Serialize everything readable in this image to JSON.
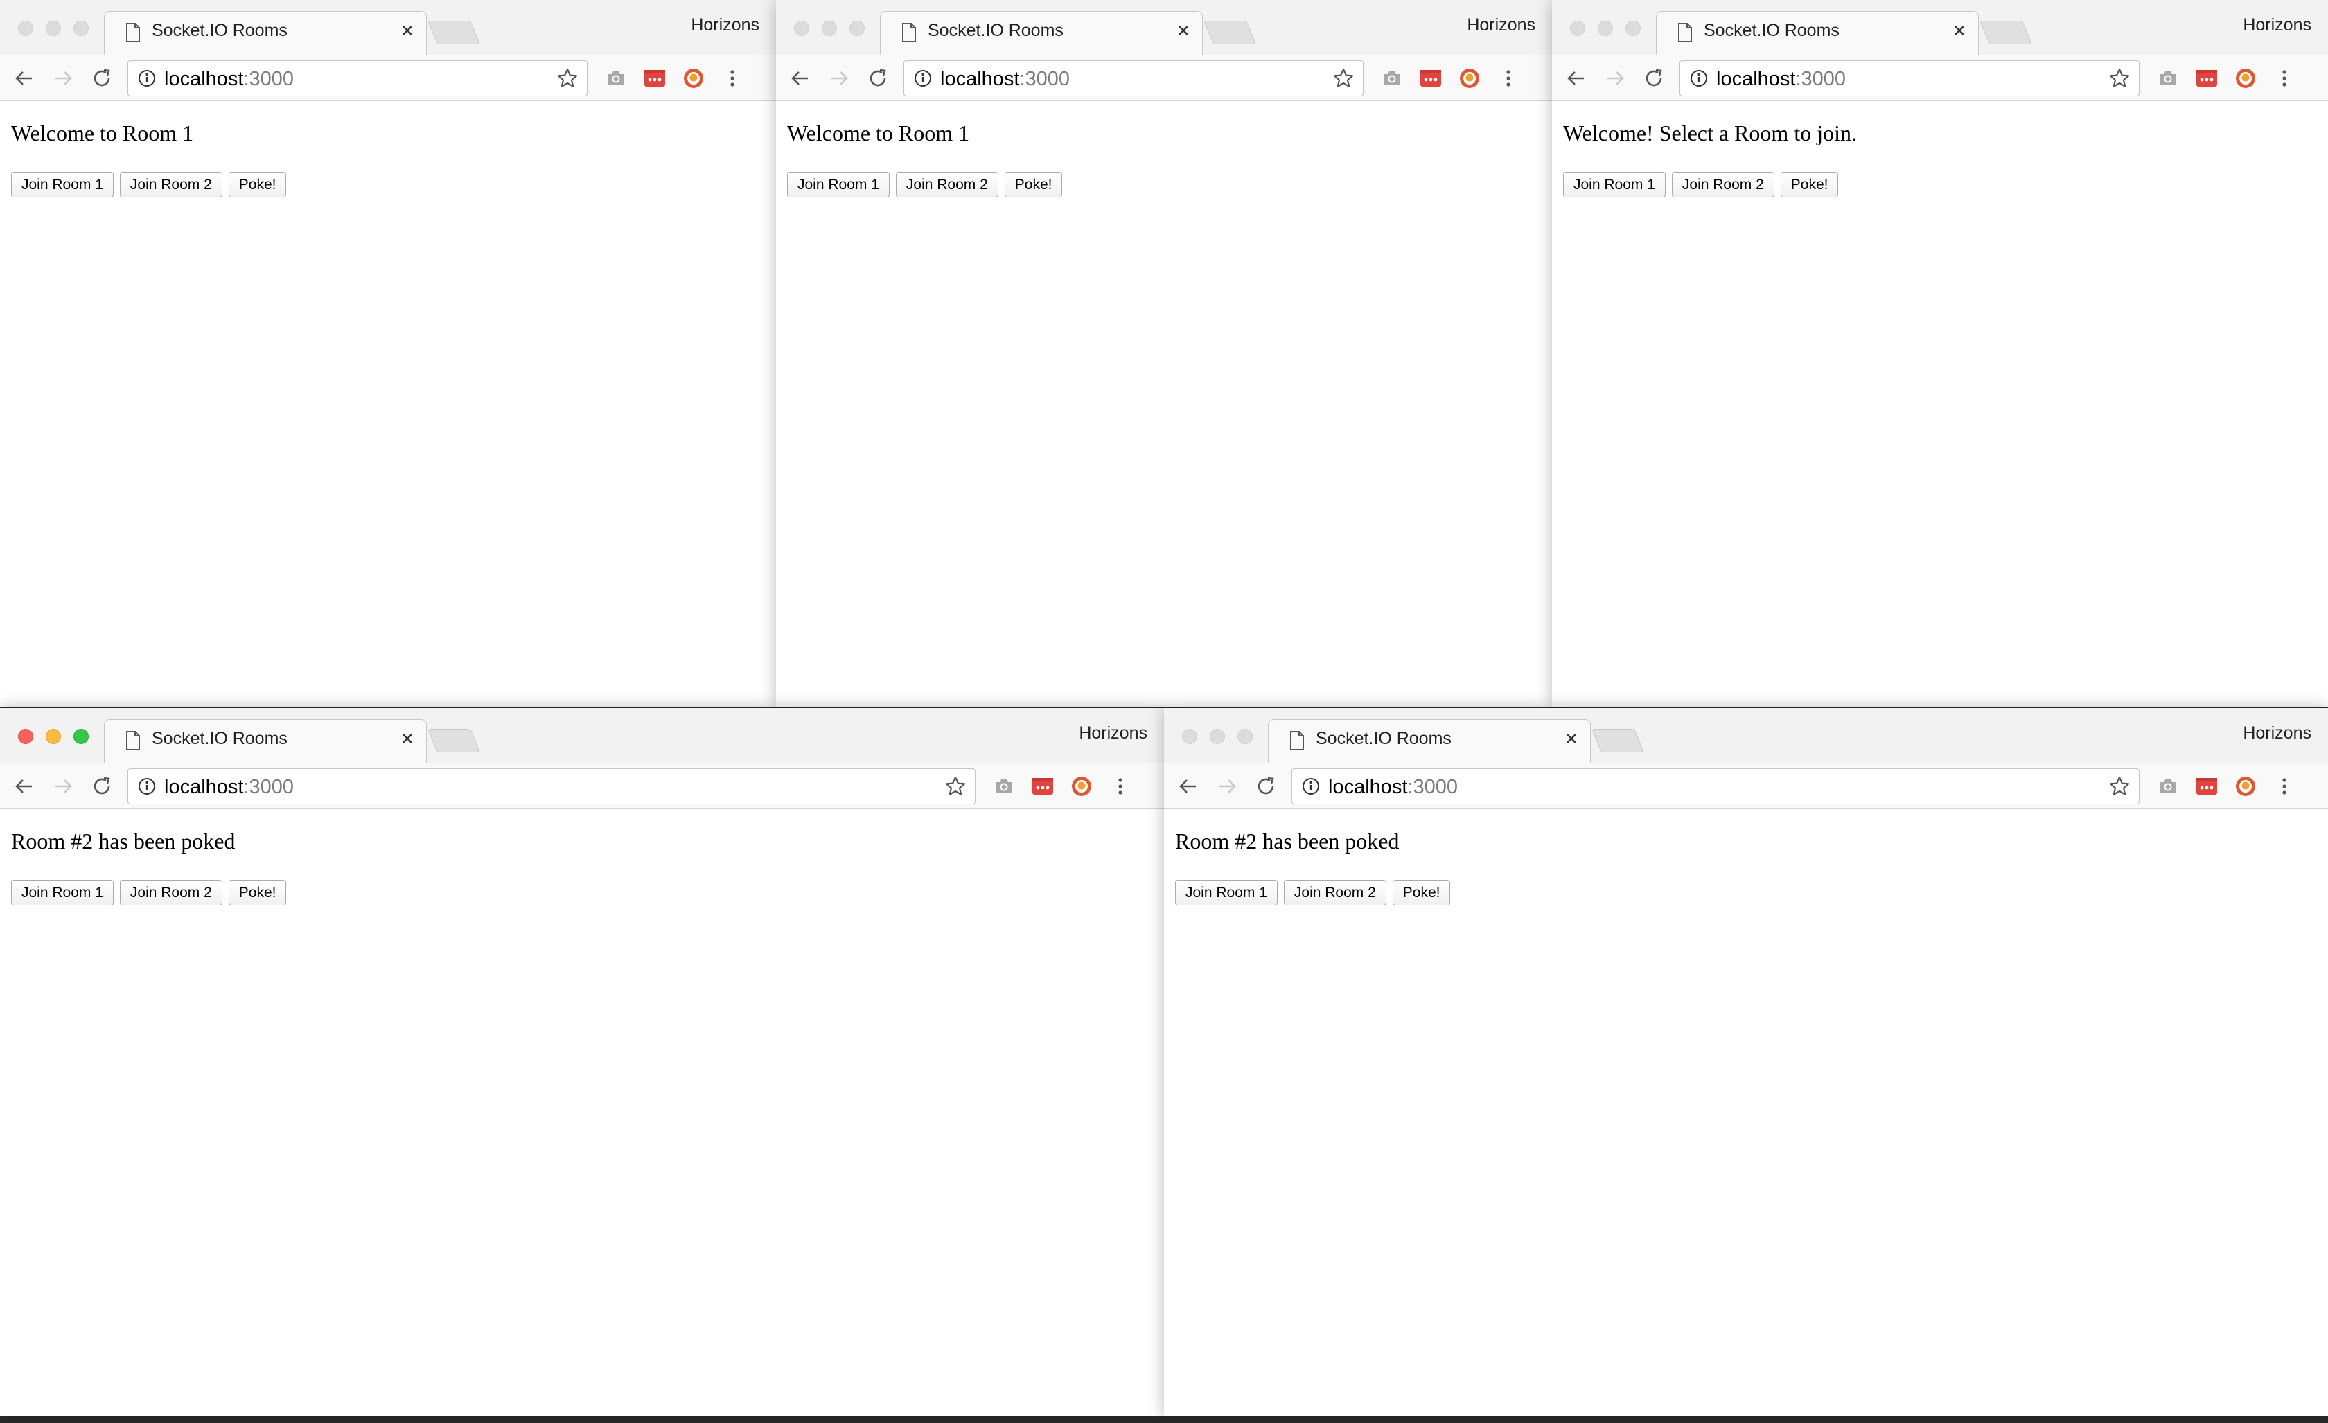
{
  "browser": {
    "tab_title": "Socket.IO Rooms",
    "profile_name": "Horizons",
    "url_host": "localhost",
    "url_port": ":3000",
    "buttons": {
      "join_room_1": "Join Room 1",
      "join_room_2": "Join Room 2",
      "poke": "Poke!"
    },
    "icons": [
      "back-arrow-icon",
      "forward-arrow-icon",
      "reload-icon",
      "info-icon",
      "star-icon",
      "camera-icon",
      "password-manager-icon",
      "duckduckgo-icon",
      "menu-dots-icon",
      "document-icon",
      "close-icon"
    ]
  },
  "windows": [
    {
      "id": "top-left",
      "message": "Welcome to Room 1",
      "active": false
    },
    {
      "id": "top-middle",
      "message": "Welcome to Room 1",
      "active": false
    },
    {
      "id": "top-right",
      "message": "Welcome! Select a Room to join.",
      "active": false
    },
    {
      "id": "bottom-left",
      "message": "Room #2 has been poked",
      "active": true
    },
    {
      "id": "bottom-right",
      "message": "Room #2 has been poked",
      "active": false
    }
  ],
  "colors": {
    "close_light": "#fc605c",
    "minimize_light": "#fcbb40",
    "zoom_light": "#34c84a",
    "password_extension": "#e0443e",
    "duckduckgo_extension": "#de5833"
  }
}
